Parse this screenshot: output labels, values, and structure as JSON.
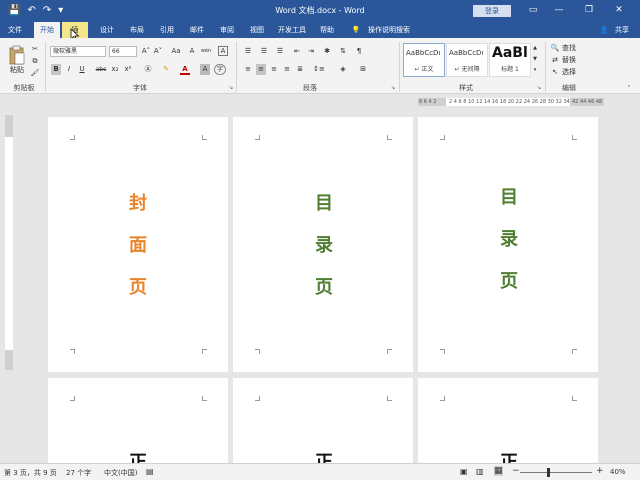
{
  "window": {
    "title": "Word 文档.docx - Word",
    "signin_label": "登录",
    "controls": {
      "ribbon_display": "▭",
      "minimize": "—",
      "restore": "❐",
      "close": "✕"
    }
  },
  "qat": {
    "save": "💾",
    "undo": "↶",
    "redo": "↷",
    "customize": "▾"
  },
  "tabs": [
    {
      "label": "文件"
    },
    {
      "label": "开始"
    },
    {
      "label": "插"
    },
    {
      "label": "设计"
    },
    {
      "label": "布局"
    },
    {
      "label": "引用"
    },
    {
      "label": "邮件"
    },
    {
      "label": "审阅"
    },
    {
      "label": "视图"
    },
    {
      "label": "开发工具"
    },
    {
      "label": "帮助"
    },
    {
      "label": "操作说明搜索"
    }
  ],
  "share_label": "共享",
  "ribbon": {
    "clipboard": {
      "paste_label": "粘贴",
      "group_label": "剪贴板"
    },
    "font": {
      "name": "微软雅黑",
      "size": "66",
      "bold": "B",
      "italic": "I",
      "underline": "U",
      "strike": "abc",
      "subscript": "x₂",
      "superscript": "x²",
      "grow": "A˄",
      "shrink": "A˅",
      "case": "Aa",
      "clear": "A",
      "phonetic": "wén",
      "charborder": "A",
      "highlight": "✎",
      "color": "A",
      "shading": "A",
      "encircle": "字",
      "group_label": "字体"
    },
    "paragraph": {
      "group_label": "段落"
    },
    "styles": {
      "items": [
        {
          "sample": "AaBbCcDı",
          "name": "↵ 正文"
        },
        {
          "sample": "AaBbCcDı",
          "name": "↵ 无间隔"
        },
        {
          "sample": "AaBl",
          "name": "标题 1"
        }
      ],
      "group_label": "样式"
    },
    "editing": {
      "find": "查找",
      "replace": "替换",
      "select": "选择",
      "group_label": "编辑"
    }
  },
  "ruler": {
    "h_left": "8 6 4 2",
    "h_mid": "2 4 6 8 10 12 14 16 18 20 22 24 26 28 30 32 34",
    "h_right": "42 44 46 48"
  },
  "pages": [
    {
      "chars": [
        "封",
        "面",
        "页"
      ],
      "color": "#e8852b"
    },
    {
      "chars": [
        "目",
        "录",
        "页"
      ],
      "color": "#507e32"
    },
    {
      "chars": [
        "目",
        "录",
        "页"
      ],
      "color": "#507e32"
    },
    {
      "chars": [],
      "color": "#111111"
    },
    {
      "chars": [
        "正"
      ],
      "color": "#111111"
    },
    {
      "chars": [
        "正"
      ],
      "color": "#111111"
    }
  ],
  "status": {
    "page": "第 3 页，共 9 页",
    "words": "27 个字",
    "language": "中文(中国)",
    "zoom": "40%"
  }
}
